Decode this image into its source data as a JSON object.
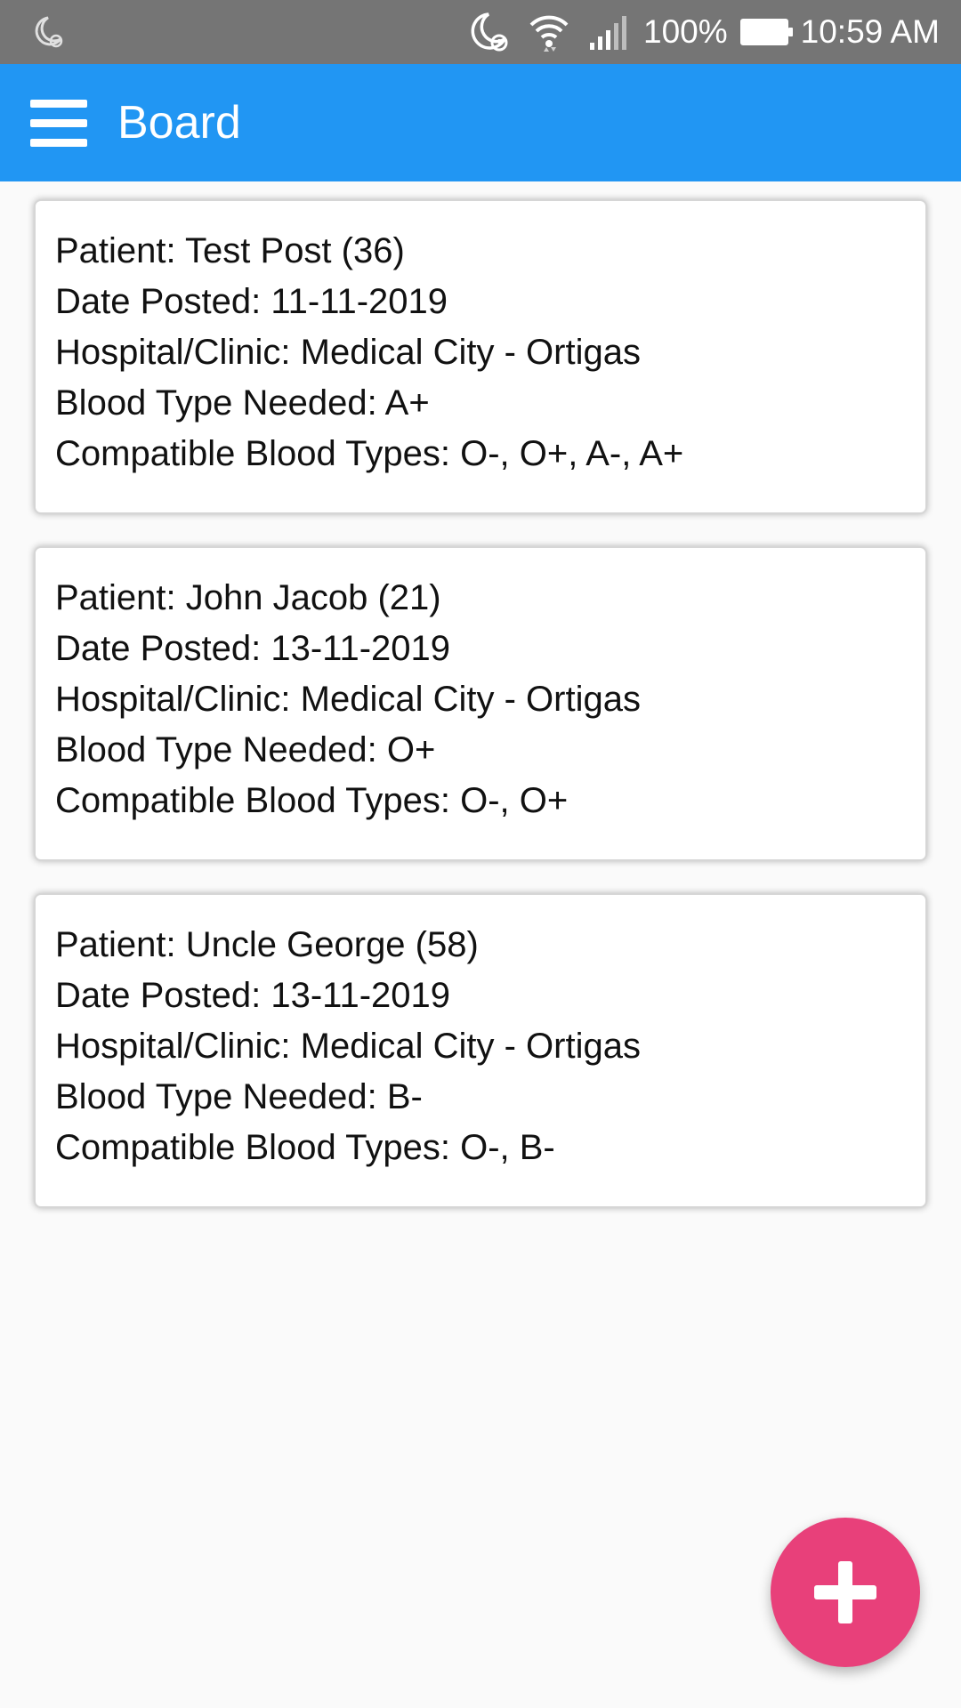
{
  "status_bar": {
    "battery": "100%",
    "time": "10:59 AM",
    "icons": [
      "moon-alarm-icon",
      "moon-alarm-icon",
      "wifi-icon",
      "signal-icon",
      "battery-icon"
    ]
  },
  "app_bar": {
    "title": "Board",
    "menu_icon": "hamburger-menu-icon",
    "color": "#2196f3"
  },
  "posts": [
    {
      "patient": "Patient: Test Post (36)",
      "date": "Date Posted: 11-11-2019",
      "hospital": "Hospital/Clinic: Medical City - Ortigas",
      "blood_type": "Blood Type Needed: A+",
      "compatible": "Compatible Blood Types: O-, O+, A-, A+"
    },
    {
      "patient": "Patient: John Jacob (21)",
      "date": "Date Posted: 13-11-2019",
      "hospital": "Hospital/Clinic: Medical City - Ortigas",
      "blood_type": "Blood Type Needed: O+",
      "compatible": "Compatible Blood Types: O-, O+"
    },
    {
      "patient": "Patient: Uncle George (58)",
      "date": "Date Posted: 13-11-2019",
      "hospital": "Hospital/Clinic: Medical City - Ortigas",
      "blood_type": "Blood Type Needed: B-",
      "compatible": "Compatible Blood Types: O-, B-"
    }
  ],
  "fab": {
    "icon": "plus-icon",
    "color": "#e8407a"
  }
}
